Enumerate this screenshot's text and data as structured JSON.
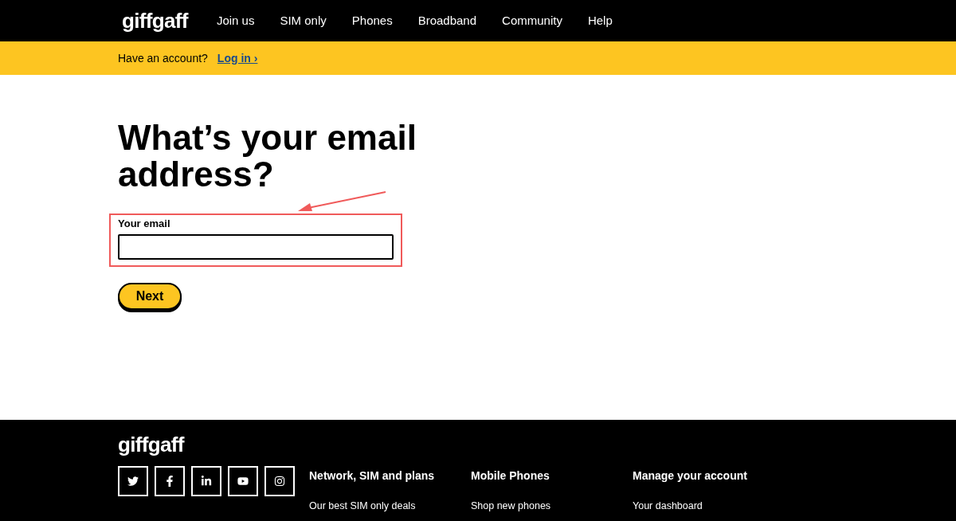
{
  "header": {
    "logo": "giffgaff",
    "nav": [
      {
        "label": "Join us"
      },
      {
        "label": "SIM only"
      },
      {
        "label": "Phones"
      },
      {
        "label": "Broadband"
      },
      {
        "label": "Community"
      },
      {
        "label": "Help"
      }
    ]
  },
  "account_bar": {
    "text": "Have an account?",
    "link": "Log in ›"
  },
  "form": {
    "heading": "What’s your email address?",
    "email_label": "Your email",
    "button": "Next"
  },
  "footer": {
    "logo": "giffgaff",
    "social": [
      {
        "kind": "twitter"
      },
      {
        "kind": "facebook"
      },
      {
        "kind": "linkedin"
      },
      {
        "kind": "youtube"
      },
      {
        "kind": "instagram"
      }
    ],
    "columns": [
      {
        "title": "Network, SIM and plans",
        "links": [
          "Our best SIM only deals"
        ]
      },
      {
        "title": "Mobile Phones",
        "links": [
          "Shop new phones"
        ]
      },
      {
        "title": "Manage your account",
        "links": [
          "Your dashboard"
        ]
      }
    ]
  }
}
